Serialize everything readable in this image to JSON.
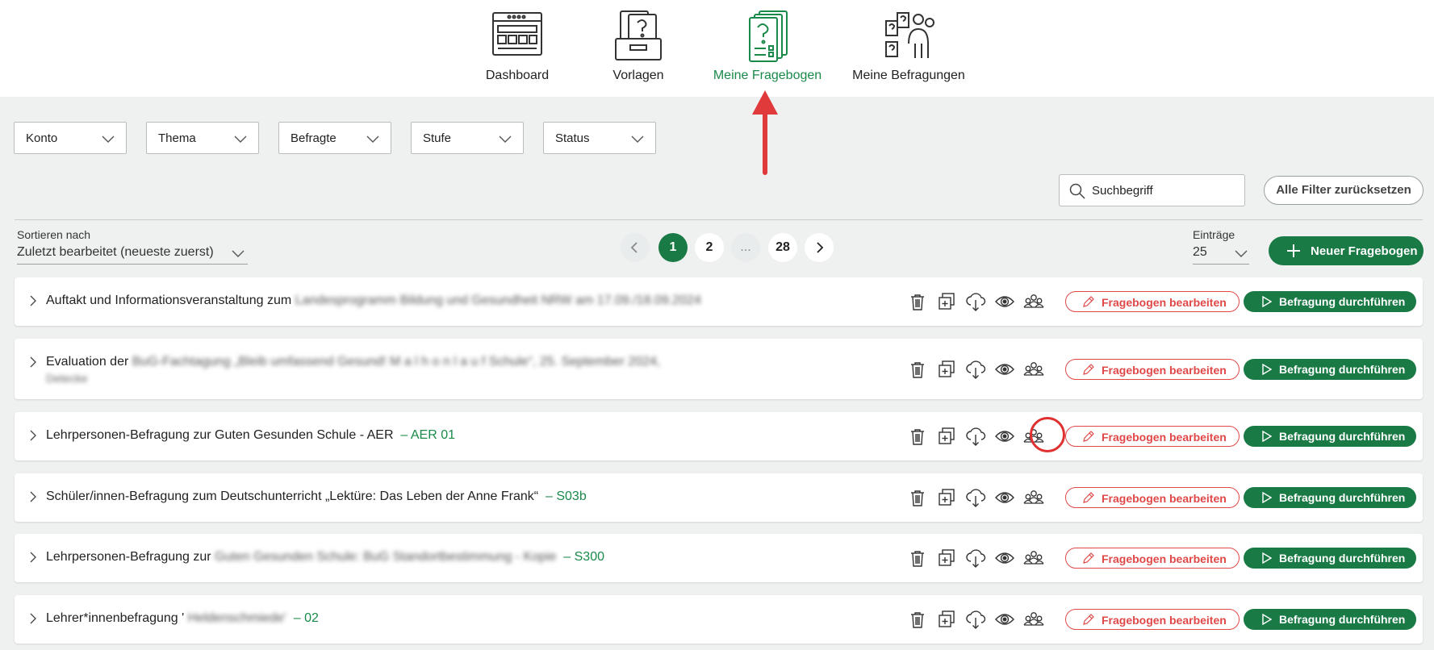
{
  "nav": {
    "items": [
      {
        "label": "Dashboard",
        "icon": "dashboard-icon",
        "active": false
      },
      {
        "label": "Vorlagen",
        "icon": "templates-icon",
        "active": false
      },
      {
        "label": "Meine Fragebogen",
        "icon": "questionnaire-icon",
        "active": true
      },
      {
        "label": "Meine Befragungen",
        "icon": "surveys-icon",
        "active": false
      }
    ]
  },
  "filters": {
    "konto": "Konto",
    "thema": "Thema",
    "befragte": "Befragte",
    "stufe": "Stufe",
    "status": "Status"
  },
  "search": {
    "placeholder": "Suchbegriff"
  },
  "reset_label": "Alle Filter zurücksetzen",
  "sort": {
    "caption": "Sortieren nach",
    "value": "Zuletzt bearbeitet (neueste zuerst)"
  },
  "pagination": {
    "pages": [
      "1",
      "2",
      "...",
      "28"
    ],
    "current": "1"
  },
  "entries": {
    "caption": "Einträge",
    "value": "25"
  },
  "new_button_label": "Neuer Fragebogen",
  "actions": {
    "edit_label": "Fragebogen bearbeiten",
    "run_label": "Befragung durchführen"
  },
  "rows": [
    {
      "title": "Auftakt und Informationsveranstaltung zum",
      "blurred": "Landesprogramm Bildung und Gesundheit NRW am 17.09./18.09.2024",
      "code": ""
    },
    {
      "title": "Evaluation der",
      "blurred": "BuG-Fachtagung „Bleib umfassend Gesund! M a l h o n l a u f Schule“, 25. September 2024,",
      "sub": "Detecke",
      "code": ""
    },
    {
      "title": "Lehrpersonen-Befragung zur Guten Gesunden Schule - AER",
      "blurred": "",
      "code": "– AER 01"
    },
    {
      "title": "Schüler/innen-Befragung zum Deutschunterricht „Lektüre: Das Leben der Anne Frank“",
      "blurred": "",
      "code": "– S03b"
    },
    {
      "title": "Lehrpersonen-Befragung zur",
      "blurred": "Guten Gesunden Schule: BuG Standortbestimmung - Kopie",
      "code": "– S300"
    },
    {
      "title": "Lehrer*innenbefragung '",
      "blurred": "Heldenschmiede'",
      "code": "– 02"
    }
  ],
  "colors": {
    "brand_green": "#1a7a45",
    "edit_red": "#e04848",
    "highlight_red": "#e03030"
  }
}
